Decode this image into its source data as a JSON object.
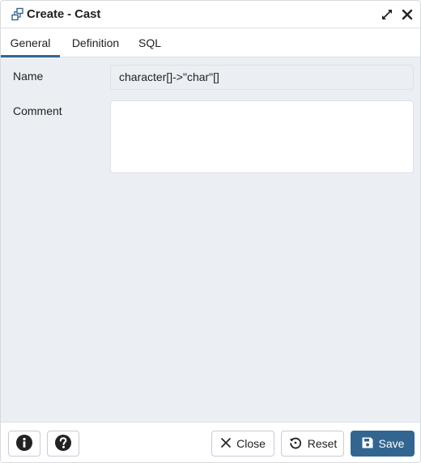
{
  "dialog": {
    "title": "Create - Cast",
    "icons": {
      "title": "cast-icon",
      "maximize": "maximize-icon",
      "close": "close-icon"
    }
  },
  "tabs": [
    {
      "label": "General",
      "active": true
    },
    {
      "label": "Definition",
      "active": false
    },
    {
      "label": "SQL",
      "active": false
    }
  ],
  "form": {
    "name_label": "Name",
    "name_value": "character[]->\"char\"[]",
    "comment_label": "Comment",
    "comment_value": ""
  },
  "footer": {
    "info_icon": "info-icon",
    "help_icon": "help-icon",
    "close_label": "Close",
    "reset_label": "Reset",
    "save_label": "Save"
  },
  "colors": {
    "accent": "#326690",
    "body_background": "#ebeef3",
    "border": "#dde0e6"
  }
}
